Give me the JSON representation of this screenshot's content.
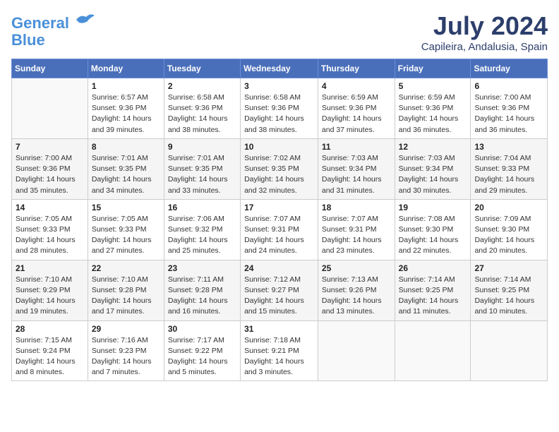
{
  "header": {
    "logo_line1": "General",
    "logo_line2": "Blue",
    "month": "July 2024",
    "location": "Capileira, Andalusia, Spain"
  },
  "days_of_week": [
    "Sunday",
    "Monday",
    "Tuesday",
    "Wednesday",
    "Thursday",
    "Friday",
    "Saturday"
  ],
  "weeks": [
    [
      {
        "day": "",
        "info": ""
      },
      {
        "day": "1",
        "info": "Sunrise: 6:57 AM\nSunset: 9:36 PM\nDaylight: 14 hours\nand 39 minutes."
      },
      {
        "day": "2",
        "info": "Sunrise: 6:58 AM\nSunset: 9:36 PM\nDaylight: 14 hours\nand 38 minutes."
      },
      {
        "day": "3",
        "info": "Sunrise: 6:58 AM\nSunset: 9:36 PM\nDaylight: 14 hours\nand 38 minutes."
      },
      {
        "day": "4",
        "info": "Sunrise: 6:59 AM\nSunset: 9:36 PM\nDaylight: 14 hours\nand 37 minutes."
      },
      {
        "day": "5",
        "info": "Sunrise: 6:59 AM\nSunset: 9:36 PM\nDaylight: 14 hours\nand 36 minutes."
      },
      {
        "day": "6",
        "info": "Sunrise: 7:00 AM\nSunset: 9:36 PM\nDaylight: 14 hours\nand 36 minutes."
      }
    ],
    [
      {
        "day": "7",
        "info": "Sunrise: 7:00 AM\nSunset: 9:36 PM\nDaylight: 14 hours\nand 35 minutes."
      },
      {
        "day": "8",
        "info": "Sunrise: 7:01 AM\nSunset: 9:35 PM\nDaylight: 14 hours\nand 34 minutes."
      },
      {
        "day": "9",
        "info": "Sunrise: 7:01 AM\nSunset: 9:35 PM\nDaylight: 14 hours\nand 33 minutes."
      },
      {
        "day": "10",
        "info": "Sunrise: 7:02 AM\nSunset: 9:35 PM\nDaylight: 14 hours\nand 32 minutes."
      },
      {
        "day": "11",
        "info": "Sunrise: 7:03 AM\nSunset: 9:34 PM\nDaylight: 14 hours\nand 31 minutes."
      },
      {
        "day": "12",
        "info": "Sunrise: 7:03 AM\nSunset: 9:34 PM\nDaylight: 14 hours\nand 30 minutes."
      },
      {
        "day": "13",
        "info": "Sunrise: 7:04 AM\nSunset: 9:33 PM\nDaylight: 14 hours\nand 29 minutes."
      }
    ],
    [
      {
        "day": "14",
        "info": "Sunrise: 7:05 AM\nSunset: 9:33 PM\nDaylight: 14 hours\nand 28 minutes."
      },
      {
        "day": "15",
        "info": "Sunrise: 7:05 AM\nSunset: 9:33 PM\nDaylight: 14 hours\nand 27 minutes."
      },
      {
        "day": "16",
        "info": "Sunrise: 7:06 AM\nSunset: 9:32 PM\nDaylight: 14 hours\nand 25 minutes."
      },
      {
        "day": "17",
        "info": "Sunrise: 7:07 AM\nSunset: 9:31 PM\nDaylight: 14 hours\nand 24 minutes."
      },
      {
        "day": "18",
        "info": "Sunrise: 7:07 AM\nSunset: 9:31 PM\nDaylight: 14 hours\nand 23 minutes."
      },
      {
        "day": "19",
        "info": "Sunrise: 7:08 AM\nSunset: 9:30 PM\nDaylight: 14 hours\nand 22 minutes."
      },
      {
        "day": "20",
        "info": "Sunrise: 7:09 AM\nSunset: 9:30 PM\nDaylight: 14 hours\nand 20 minutes."
      }
    ],
    [
      {
        "day": "21",
        "info": "Sunrise: 7:10 AM\nSunset: 9:29 PM\nDaylight: 14 hours\nand 19 minutes."
      },
      {
        "day": "22",
        "info": "Sunrise: 7:10 AM\nSunset: 9:28 PM\nDaylight: 14 hours\nand 17 minutes."
      },
      {
        "day": "23",
        "info": "Sunrise: 7:11 AM\nSunset: 9:28 PM\nDaylight: 14 hours\nand 16 minutes."
      },
      {
        "day": "24",
        "info": "Sunrise: 7:12 AM\nSunset: 9:27 PM\nDaylight: 14 hours\nand 15 minutes."
      },
      {
        "day": "25",
        "info": "Sunrise: 7:13 AM\nSunset: 9:26 PM\nDaylight: 14 hours\nand 13 minutes."
      },
      {
        "day": "26",
        "info": "Sunrise: 7:14 AM\nSunset: 9:25 PM\nDaylight: 14 hours\nand 11 minutes."
      },
      {
        "day": "27",
        "info": "Sunrise: 7:14 AM\nSunset: 9:25 PM\nDaylight: 14 hours\nand 10 minutes."
      }
    ],
    [
      {
        "day": "28",
        "info": "Sunrise: 7:15 AM\nSunset: 9:24 PM\nDaylight: 14 hours\nand 8 minutes."
      },
      {
        "day": "29",
        "info": "Sunrise: 7:16 AM\nSunset: 9:23 PM\nDaylight: 14 hours\nand 7 minutes."
      },
      {
        "day": "30",
        "info": "Sunrise: 7:17 AM\nSunset: 9:22 PM\nDaylight: 14 hours\nand 5 minutes."
      },
      {
        "day": "31",
        "info": "Sunrise: 7:18 AM\nSunset: 9:21 PM\nDaylight: 14 hours\nand 3 minutes."
      },
      {
        "day": "",
        "info": ""
      },
      {
        "day": "",
        "info": ""
      },
      {
        "day": "",
        "info": ""
      }
    ]
  ]
}
